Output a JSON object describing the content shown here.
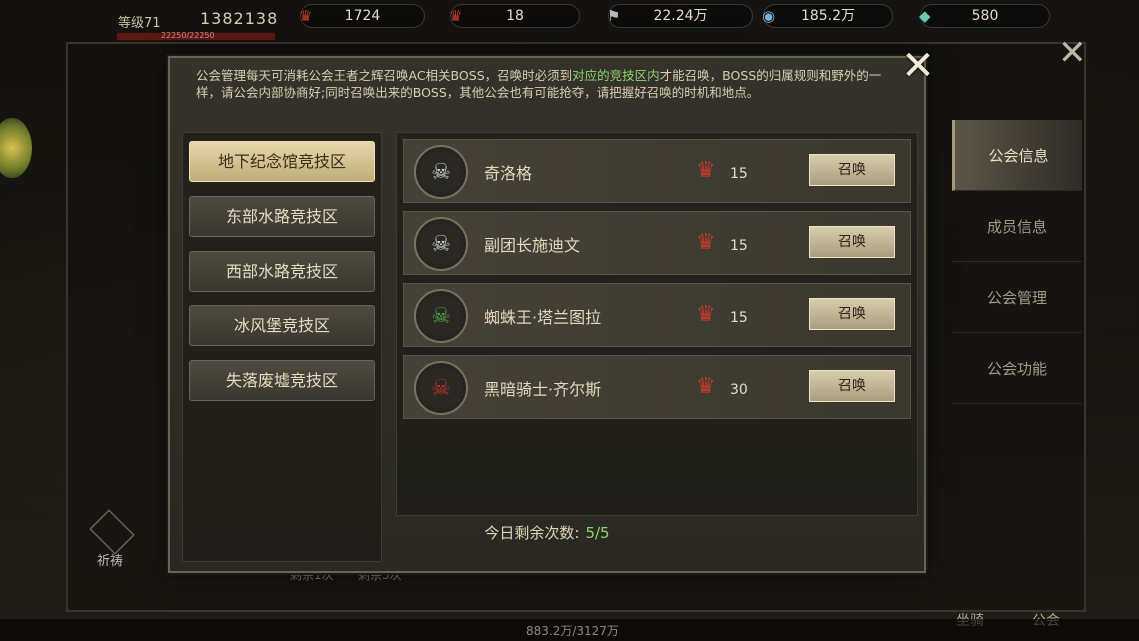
{
  "player": {
    "level_label": "等级71",
    "power": "1382138",
    "hp_text": "22250/22250"
  },
  "resources": [
    {
      "icon": "crown-icon",
      "value": "1724"
    },
    {
      "icon": "crown-icon",
      "value": "18"
    },
    {
      "icon": "flag-icon",
      "value": "22.24万"
    },
    {
      "icon": "coin-icon",
      "value": "185.2万"
    },
    {
      "icon": "gem-icon",
      "value": "580"
    }
  ],
  "side_tabs": [
    "公会信息",
    "成员信息",
    "公会管理",
    "公会功能"
  ],
  "background": {
    "bottom_left_label": "祈祷",
    "left_counts": [
      "剩余1次",
      "剩余3次"
    ],
    "bottom_right_labels": [
      "坐骑",
      "公会"
    ],
    "bottom_status": "883.2万/3127万"
  },
  "modal": {
    "notice_part1": "公会管理每天可消耗公会王者之辉召唤AC相关BOSS，召唤时必须到",
    "notice_highlight": "对应的竞技区内",
    "notice_part2": "才能召唤，BOSS的归属规则和野外的一样，请公会内部协商好;同时召唤出来的BOSS，其他公会也有可能抢夺，请把握好召唤的时机和地点。",
    "areas": [
      "地下纪念馆竞技区",
      "东部水路竞技区",
      "西部水路竞技区",
      "冰风堡竞技区",
      "失落废墟竞技区"
    ],
    "active_area_index": 0,
    "bosses": [
      {
        "name": "奇洛格",
        "cost": "15",
        "button": "召唤",
        "emblem_color": "#cfcfcf"
      },
      {
        "name": "副团长施迪文",
        "cost": "15",
        "button": "召唤",
        "emblem_color": "#cfcfcf"
      },
      {
        "name": "蜘蛛王·塔兰图拉",
        "cost": "15",
        "button": "召唤",
        "emblem_color": "#4fa24a"
      },
      {
        "name": "黑暗骑士·齐尔斯",
        "cost": "30",
        "button": "召唤",
        "emblem_color": "#c2302a"
      }
    ],
    "remaining_label": "今日剩余次数:",
    "remaining_value": "5/5"
  },
  "colors": {
    "highlight": "#8fd46a",
    "cost_icon": "#c23a2c",
    "active_area_bg": "#e6d7a9"
  }
}
